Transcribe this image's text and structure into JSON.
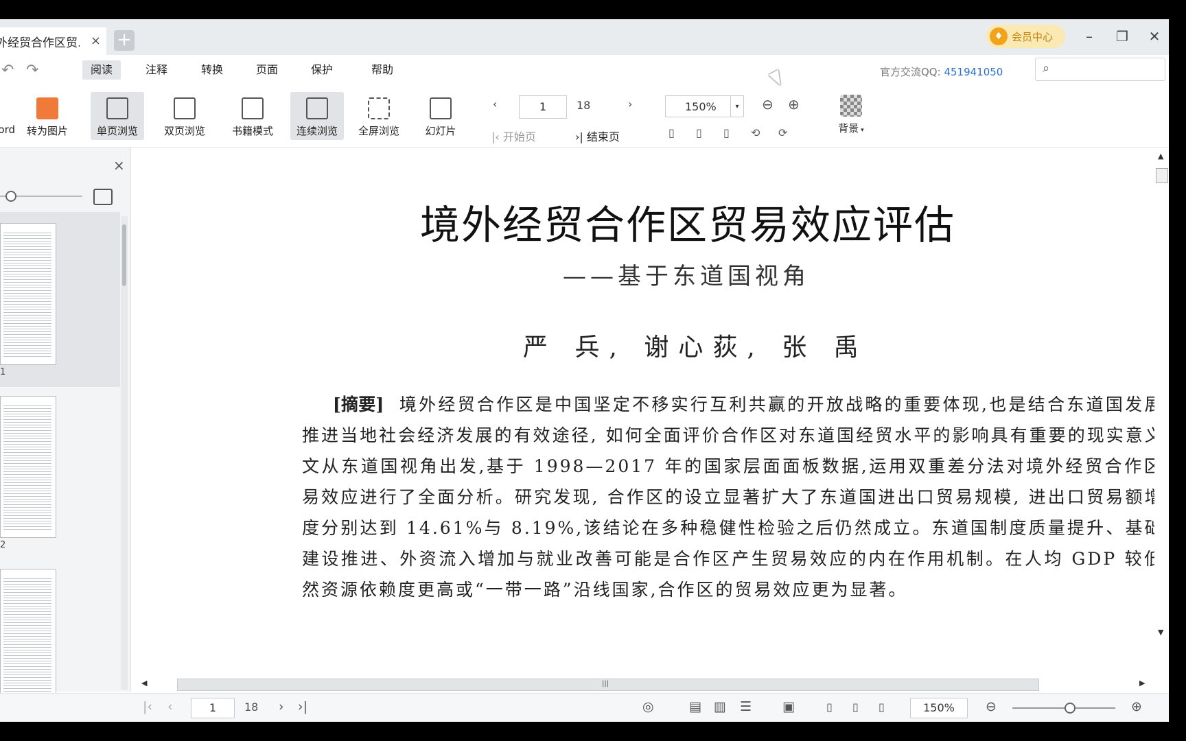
{
  "titlebar": {
    "tab_title": "外经贸合作区贸...",
    "close_glyph": "×",
    "new_tab_glyph": "+",
    "vip_label": "会员中心",
    "minimize": "–",
    "restore": "❐",
    "close": "✕"
  },
  "menubar": {
    "items": [
      "阅读",
      "注释",
      "转换",
      "页面",
      "保护",
      "帮助"
    ],
    "active": "阅读",
    "qq_label": "官方交流QQ:",
    "qq_number": "451941050",
    "search_placeholder": ""
  },
  "toolbar": {
    "partial_label": "ord",
    "to_image": "转为图片",
    "single_page": "单页浏览",
    "double_page": "双页浏览",
    "book_mode": "书籍模式",
    "continuous": "连续浏览",
    "fullscreen": "全屏浏览",
    "slideshow": "幻灯片",
    "current_page": "1",
    "total_pages": "18",
    "first_page": "开始页",
    "last_page": "结束页",
    "zoom": "150%",
    "background": "背景"
  },
  "sidebar": {
    "close_glyph": "×",
    "thumbnails": [
      {
        "label": "1"
      },
      {
        "label": "2"
      },
      {
        "label": ""
      }
    ]
  },
  "document": {
    "title": "境外经贸合作区贸易效应评估",
    "subtitle": "——基于东道国视角",
    "authors": "严 兵, 谢心荻, 张 禹",
    "abstract_label": "[摘要]",
    "abstract_text": "境外经贸合作区是中国坚定不移实行互利共赢的开放战略的重要体现,也是结合东道国发展需求推进当地社会经济发展的有效途径, 如何全面评价合作区对东道国经贸水平的影响具有重要的现实意义。本文从东道国视角出发,基于 1998—2017 年的国家层面面板数据,运用双重差分法对境外经贸合作区的贸易效应进行了全面分析。研究发现, 合作区的设立显著扩大了东道国进出口贸易规模, 进出口贸易额增长幅度分别达到 14.61%与 8.19%,该结论在多种稳健性检验之后仍然成立。东道国制度质量提升、基础设施建设推进、外资流入增加与就业改善可能是合作区产生贸易效应的内在作用机制。在人均 GDP 较低、自然资源依赖度更高或“一带一路”沿线国家,合作区的贸易效应更为显著。"
  },
  "statusbar": {
    "current_page": "1",
    "total_pages": "18",
    "zoom": "150%"
  },
  "colors": {
    "accent_link": "#2b6fcf",
    "vip_bg": "#fbe9b4",
    "vip_text": "#c0840c",
    "toolbar_selected": "#e1e3e6"
  }
}
